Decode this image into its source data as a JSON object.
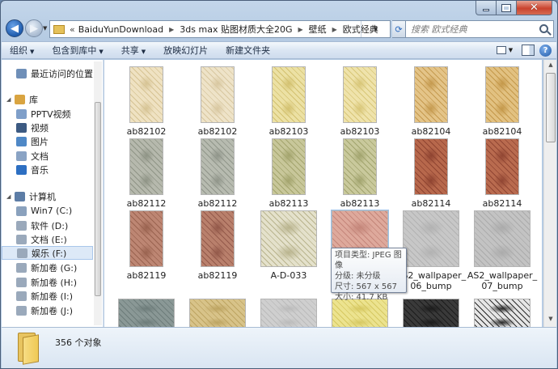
{
  "window": {
    "caption_buttons": {
      "minimize": "minimize",
      "maximize": "maximize",
      "close": "✕"
    }
  },
  "nav": {
    "back_glyph": "◀",
    "forward_glyph": "▶",
    "address_prefix": "«",
    "breadcrumb": [
      "BaiduYunDownload",
      "3ds max 贴图材质大全20G",
      "壁纸",
      "欧式经典"
    ],
    "search_placeholder": "搜索 欧式经典"
  },
  "toolbar": {
    "items": [
      "组织",
      "包含到库中",
      "共享",
      "放映幻灯片",
      "新建文件夹"
    ]
  },
  "sidebar": {
    "items": [
      {
        "label": "最近访问的位置",
        "icon": "recent-places-icon",
        "color": "#6f8fb8"
      },
      {
        "label": "库",
        "icon": "library-icon",
        "color": "#d9a441"
      },
      {
        "label": "PPTV视频",
        "icon": "library-folder-icon",
        "color": "#7f9fc9"
      },
      {
        "label": "视频",
        "icon": "video-library-icon",
        "color": "#3c5a82"
      },
      {
        "label": "图片",
        "icon": "picture-library-icon",
        "color": "#4f88c6"
      },
      {
        "label": "文档",
        "icon": "document-library-icon",
        "color": "#8aa3c4"
      },
      {
        "label": "音乐",
        "icon": "music-library-icon",
        "color": "#2d6fc2"
      },
      {
        "label": "计算机",
        "icon": "computer-icon",
        "color": "#5d7da6"
      },
      {
        "label": "Win7 (C:)",
        "icon": "drive-c-icon",
        "color": "#8aa1bd"
      },
      {
        "label": "软件 (D:)",
        "icon": "drive-icon",
        "color": "#9aa9bb"
      },
      {
        "label": "文档 (E:)",
        "icon": "drive-icon",
        "color": "#9aa9bb"
      },
      {
        "label": "娱乐 (F:)",
        "icon": "drive-icon",
        "color": "#9aa9bb"
      },
      {
        "label": "新加卷 (G:)",
        "icon": "drive-icon",
        "color": "#9aa9bb"
      },
      {
        "label": "新加卷 (H:)",
        "icon": "drive-icon",
        "color": "#9aa9bb"
      },
      {
        "label": "新加卷 (I:)",
        "icon": "drive-icon",
        "color": "#9aa9bb"
      },
      {
        "label": "新加卷 (J:)",
        "icon": "drive-icon",
        "color": "#9aa9bb"
      }
    ]
  },
  "files": [
    {
      "name": "ab82102",
      "colors": [
        "#efe2c2",
        "#d6c394"
      ]
    },
    {
      "name": "ab82102",
      "colors": [
        "#eee3c8",
        "#d8c7a0"
      ]
    },
    {
      "name": "ab82103",
      "colors": [
        "#ece1a4",
        "#d3c170"
      ]
    },
    {
      "name": "ab82103",
      "colors": [
        "#efe3ab",
        "#d8c678"
      ]
    },
    {
      "name": "ab82104",
      "colors": [
        "#e4c488",
        "#c59a4f"
      ]
    },
    {
      "name": "ab82104",
      "colors": [
        "#e2c181",
        "#c4984a"
      ]
    },
    {
      "name": "ab82112",
      "colors": [
        "#b6b9ad",
        "#8f9486"
      ]
    },
    {
      "name": "ab82112",
      "colors": [
        "#b7bbb0",
        "#90958a"
      ]
    },
    {
      "name": "ab82113",
      "colors": [
        "#c8c79a",
        "#a3a46d"
      ]
    },
    {
      "name": "ab82113",
      "colors": [
        "#c9c99c",
        "#a2a46e"
      ]
    },
    {
      "name": "ab82114",
      "colors": [
        "#b7684c",
        "#8f4431"
      ]
    },
    {
      "name": "ab82114",
      "colors": [
        "#b96b4f",
        "#914633"
      ]
    },
    {
      "name": "ab82119",
      "colors": [
        "#bd8673",
        "#9a6350"
      ]
    },
    {
      "name": "ab82119",
      "colors": [
        "#b9806c",
        "#93594a"
      ]
    },
    {
      "name": "A-D-033",
      "colors": [
        "#e4e1cb",
        "#b9b48e"
      ]
    },
    {
      "name": "",
      "colors": [
        "#dea99c",
        "#c4867a"
      ]
    },
    {
      "name": "AS2_wallpaper_06_bump",
      "colors": [
        "#c7c7c7",
        "#b2b2b2"
      ]
    },
    {
      "name": "AS2_wallpaper_07_bump",
      "colors": [
        "#c3c3c3",
        "#ababab"
      ]
    },
    {
      "name": "",
      "colors": [
        "#8a9896",
        "#6d7c7a"
      ]
    },
    {
      "name": "",
      "colors": [
        "#d8c389",
        "#bda462"
      ]
    },
    {
      "name": "",
      "colors": [
        "#cfcfcf",
        "#bbbbbb"
      ]
    },
    {
      "name": "",
      "colors": [
        "#ece38f",
        "#d6c862"
      ]
    },
    {
      "name": "",
      "colors": [
        "#3a3a3a",
        "#1c1c1c"
      ]
    },
    {
      "name": "",
      "colors": [
        "#e6e6e6",
        "#2a2a2a"
      ]
    }
  ],
  "tooltip": {
    "lines": [
      "项目类型: JPEG 图像",
      "分级: 未分级",
      "尺寸: 567 x 567",
      "大小: 41.7 KB"
    ]
  },
  "status": {
    "count_text": "356 个对象"
  }
}
